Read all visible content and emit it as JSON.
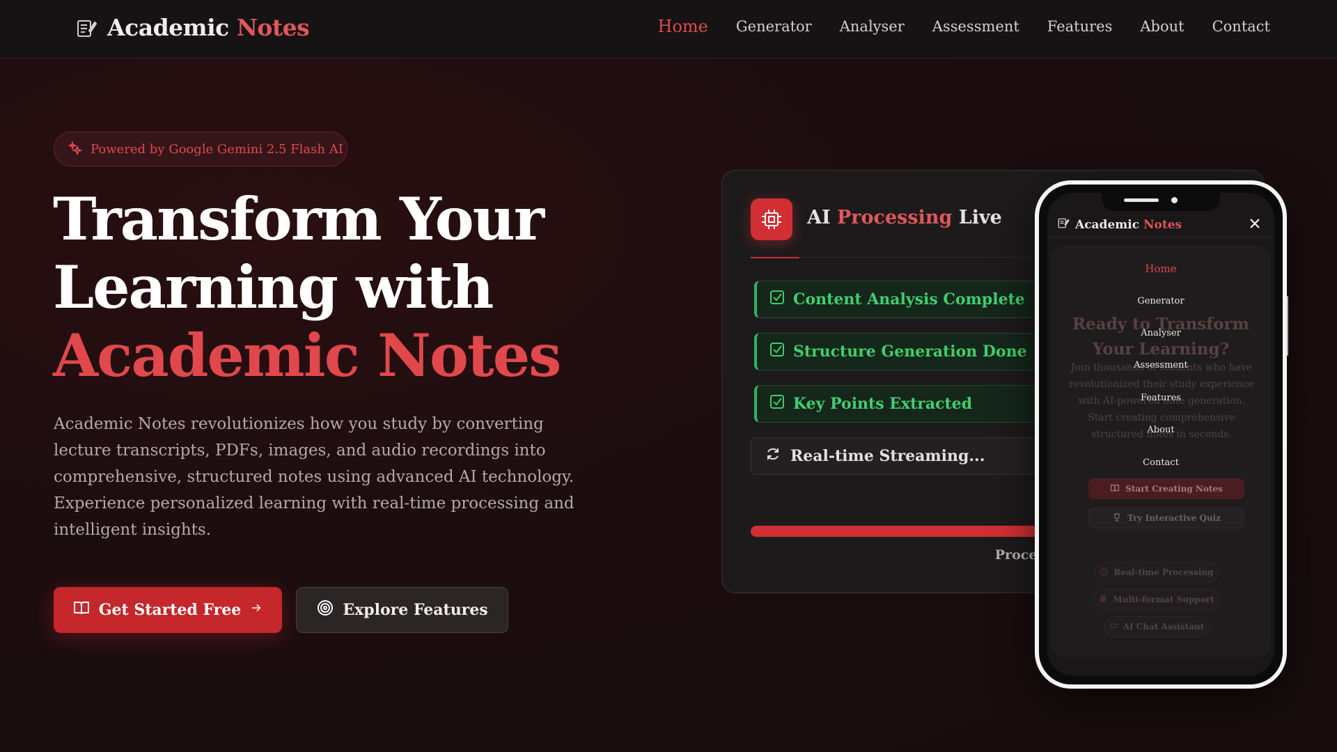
{
  "nav": {
    "brand_part1": "Academic",
    "brand_part2": "Notes",
    "links": [
      "Home",
      "Generator",
      "Analyser",
      "Assessment",
      "Features",
      "About",
      "Contact"
    ],
    "active": "Home"
  },
  "hero": {
    "badge": "Powered by Google Gemini 2.5 Flash AI",
    "title_line1": "Transform Your",
    "title_line2": "Learning with",
    "title_accent": "Academic Notes",
    "description": "Academic Notes revolutionizes how you study by converting lecture transcripts, PDFs, images, and audio recordings into comprehensive, structured notes using advanced AI technology. Experience personalized learning with real-time processing and intelligent insights.",
    "primary_button": "Get Started Free",
    "secondary_button": "Explore Features"
  },
  "panel": {
    "title_part1": "AI",
    "title_part2": "Processing",
    "title_part3": "Live",
    "steps": [
      "Content Analysis Complete",
      "Structure Generation Done",
      "Key Points Extracted"
    ],
    "streaming": "Real-time Streaming...",
    "progress_text": "Processing: 87%",
    "progress_value": 0.87
  },
  "mobile": {
    "brand_part1": "Academic",
    "brand_part2": "Notes",
    "menu": [
      "Home",
      "Generator",
      "Analyser",
      "Assessment",
      "Features",
      "About",
      "Contact"
    ],
    "bg_title": "Ready to Transform Your Learning?",
    "bg_desc": "Join thousands of students who have revolutionized their study experience with AI-powered note generation. Start creating comprehensive structured notes in seconds.",
    "primary_button": "Start Creating Notes",
    "secondary_button": "Try Interactive Quiz",
    "features": [
      "Real-time Processing",
      "Multi-format Support",
      "AI Chat Assistant"
    ]
  },
  "colors": {
    "accent": "#d12f33",
    "accent_text": "#e0484c",
    "success": "#3fcf6e",
    "nav_bg": "#161314"
  }
}
